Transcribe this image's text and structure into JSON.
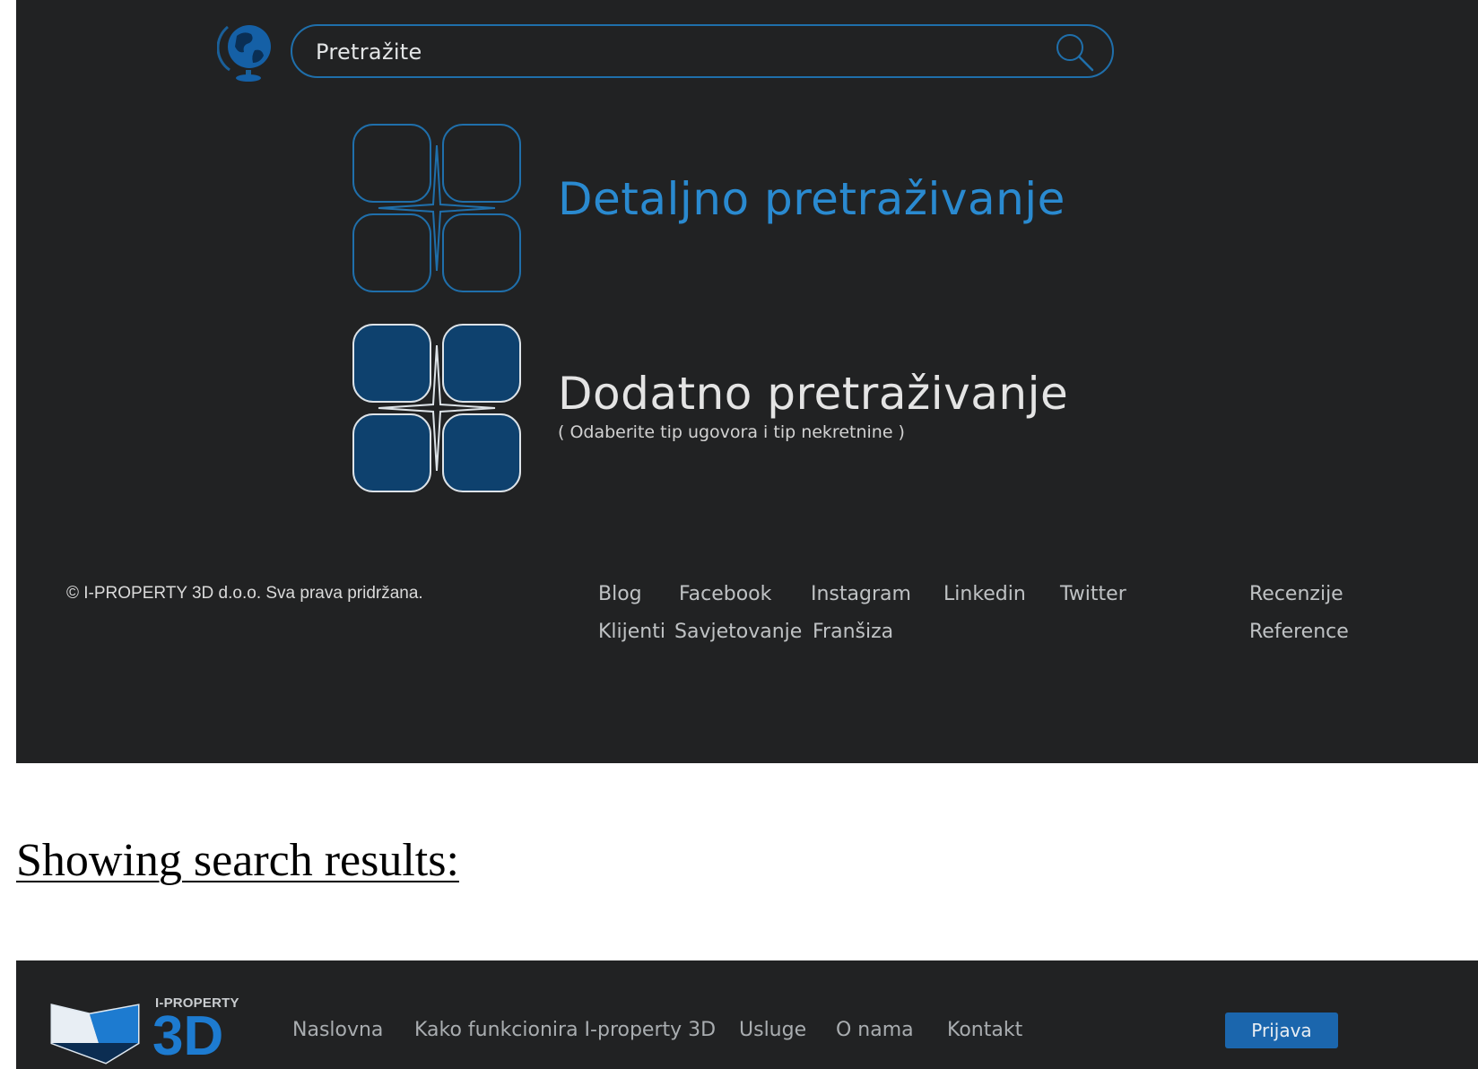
{
  "top_page": {
    "search": {
      "text": "Pretražite"
    },
    "options": [
      {
        "title": "Detaljno pretraživanje",
        "subtitle": ""
      },
      {
        "title": "Dodatno pretraživanje",
        "subtitle": "( Odaberite tip ugovora i tip nekretnine )"
      }
    ],
    "footer": {
      "copyright": "© I-PROPERTY 3D d.o.o. Sva prava pridržana.",
      "links": [
        "Blog",
        "Facebook",
        "Instagram",
        "Linkedin",
        "Twitter",
        "Recenzije",
        "Klijenti",
        "Savjetovanje",
        "Franšiza",
        "Reference"
      ]
    }
  },
  "results_heading": "Showing search results:",
  "bottom_page": {
    "logo": {
      "small": "I-PROPERTY",
      "big": "3D"
    },
    "nav": [
      "Naslovna",
      "Kako funkcionira I-property 3D",
      "Usluge",
      "O nama",
      "Kontakt"
    ],
    "login_label": "Prijava"
  },
  "colors": {
    "background": "#212223",
    "accent": "#1f6fab",
    "accent_fill": "#0e416e",
    "detail_title": "#2a8ad0",
    "button": "#1b66ad"
  },
  "icons": {
    "globe": "globe-icon",
    "search": "search-icon",
    "detail": "outline-tiles-icon",
    "extra": "filled-tiles-icon",
    "logo": "house-logo-icon"
  }
}
